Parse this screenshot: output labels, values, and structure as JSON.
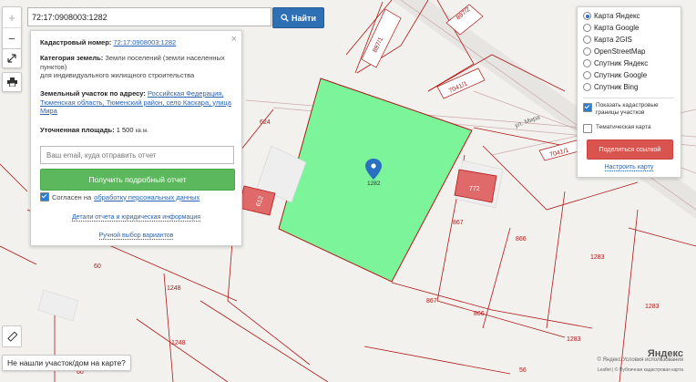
{
  "search": {
    "value": "72:17:0908003:1282",
    "button_label": "Найти"
  },
  "info": {
    "cadastral_label": "Кадастровый номер:",
    "cadastral_value": "72:17:0908003:1282",
    "category_label": "Категория земель:",
    "category_value": "Земли поселений (земли населенных пунктов)",
    "category_use": "для индивидуального жилищного строительства",
    "address_label": "Земельный участок по адресу:",
    "address_value": "Российская Федерация, Тюменская область, Тюменский район, село Каскара, улица Мира",
    "area_label": "Уточненная площадь:",
    "area_value": "1 500",
    "area_unit": "кв.м.",
    "email_placeholder": "Ваш email, куда отправить отчет",
    "report_button": "Получить подробный отчет",
    "consent_prefix": "Согласен на",
    "consent_link": "обработку персональных данных",
    "details_link": "Детали отчета и юридическая информация",
    "manual_link": "Ручной выбор вариантов"
  },
  "layers": {
    "options": [
      {
        "label": "Карта Яндекс",
        "selected": true
      },
      {
        "label": "Карта Google",
        "selected": false
      },
      {
        "label": "Карта 2GIS",
        "selected": false
      },
      {
        "label": "OpenStreetMap",
        "selected": false
      },
      {
        "label": "Спутник Яндекс",
        "selected": false
      },
      {
        "label": "Спутник Google",
        "selected": false
      },
      {
        "label": "Спутник Bing",
        "selected": false
      }
    ],
    "show_boundaries": "Показать кадастровые границы участков",
    "thematic_map": "Тематическая карта",
    "share_button": "Поделиться ссылкой",
    "setup_link": "Настроить карту"
  },
  "map": {
    "plot_number": "1282",
    "street_name": "ул. Мира",
    "house_612": "612",
    "house_772": "772",
    "labels": [
      "897/2",
      "897/1",
      "7041/1",
      "7041/1",
      "624",
      "867",
      "866",
      "1283",
      "60",
      "1248",
      "1248",
      "867",
      "866",
      "1283",
      "1283",
      "60",
      "56"
    ],
    "colors": {
      "selected_plot": "#7cf59a",
      "boundary": "#b01818",
      "building": "#e06a6a"
    }
  },
  "not_found": "Не нашли участок/дом на карте?",
  "attribution": "© Яндекс  Условия использования",
  "attribution2": "Leaflet | © Публичная кадастровая карта",
  "logo": "Яндекс"
}
